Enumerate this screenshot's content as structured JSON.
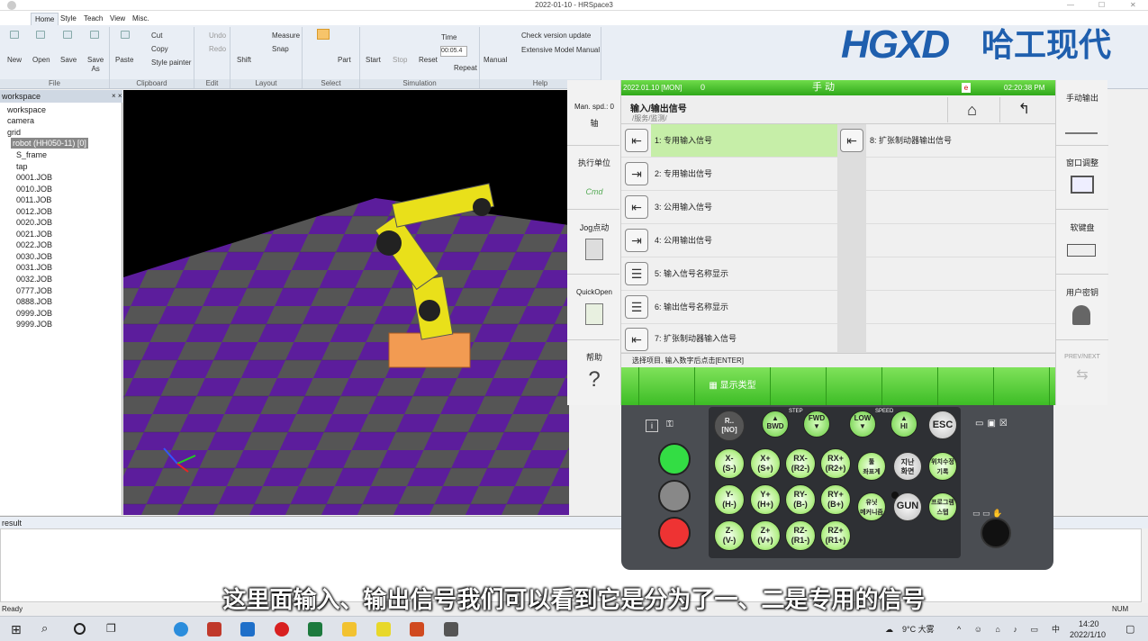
{
  "window": {
    "title": "2022-01-10 - HRSpace3"
  },
  "ribbon": {
    "tabs": [
      "Home",
      "Style",
      "Teach",
      "View",
      "Misc."
    ],
    "file": {
      "label": "File",
      "new": "New",
      "open": "Open",
      "save": "Save",
      "save_as": "Save\nAs"
    },
    "clipboard": {
      "label": "Clipboard",
      "paste": "Paste",
      "cut": "Cut",
      "copy": "Copy",
      "painter": "Style painter"
    },
    "edit": {
      "label": "Edit",
      "undo": "Undo",
      "redo": "Redo"
    },
    "layout": {
      "label": "Layout",
      "shift": "Shift",
      "measure": "Measure",
      "snap": "Snap"
    },
    "select": {
      "label": "Select",
      "part": "Part"
    },
    "simulation": {
      "label": "Simulation",
      "start": "Start",
      "stop": "Stop",
      "reset": "Reset",
      "time_label": "Time",
      "time_value": "00:05.4",
      "repeat": "Repeat"
    },
    "help": {
      "label": "Help",
      "manual": "Manual",
      "check": "Check version update",
      "ext": "Extensive Model Manual"
    }
  },
  "logo": {
    "en": "HGXD",
    "cn": "哈工现代"
  },
  "workspace": {
    "title": "workspace",
    "items": [
      "workspace",
      "camera",
      "grid",
      "robot (HH050-11) [0]",
      "S_frame",
      "tap",
      "0001.JOB",
      "0010.JOB",
      "0011.JOB",
      "0012.JOB",
      "0020.JOB",
      "0021.JOB",
      "0022.JOB",
      "0030.JOB",
      "0031.JOB",
      "0032.JOB",
      "0777.JOB",
      "0888.JOB",
      "0999.JOB",
      "9999.JOB"
    ]
  },
  "result": {
    "title": "result"
  },
  "status": {
    "left": "Ready",
    "right": "NUM"
  },
  "subtitle": "这里面输入、输出信号我们可以看到它是分为了一、二是专用的信号",
  "pendant": {
    "top": {
      "date": "2022.01.10 [MON]",
      "count": "0",
      "mode": "手  动",
      "time": "02:20:38 PM"
    },
    "title": "输入/输出信号",
    "path": "/服务/监测/",
    "left": {
      "speed": "Man. spd.: 0",
      "axis": "轴",
      "exec": "执行单位",
      "cmd": "Cmd",
      "jog": "Jog点动",
      "quick": "QuickOpen",
      "help": "帮助"
    },
    "right": {
      "manual": "手动输出",
      "window": "窗口调整",
      "keyboard": "软键盘",
      "user": "用户密钥",
      "prev_next": "PREV/NEXT"
    },
    "menu": [
      "1: 专用输入信号",
      "2: 专用输出信号",
      "3: 公用输入信号",
      "4: 公用输出信号",
      "5: 输入信号名称显示",
      "6: 输出信号名称显示",
      "7: 扩张制动器输入信号"
    ],
    "menu_right": [
      "8: 扩张制动器输出信号"
    ],
    "message": "选择项目, 输入数字后点击[ENTER]",
    "fkey": "显示类型"
  },
  "pad": {
    "step": "STEP",
    "speed": "SPEED",
    "bwd": "BWD",
    "fwd": "FWD",
    "low": "LOW",
    "hi": "HI",
    "esc": "ESC",
    "rno": "R..\n[NO]",
    "axes": [
      [
        "X-\n(S-)",
        "X+\n(S+)",
        "RX-\n(R2-)",
        "RX+\n(R2+)"
      ],
      [
        "Y-\n(H-)",
        "Y+\n(H+)",
        "RY-\n(B-)",
        "RY+\n(B+)"
      ],
      [
        "Z-\n(V-)",
        "Z+\n(V+)",
        "RZ-\n(R1-)",
        "RZ+\n(R1+)"
      ]
    ],
    "k1": "툴\n좌표계",
    "k2": "지난\n화면",
    "k3": "위치수정\n기록",
    "k4": "유닛\n메커니즘",
    "k5": "GUN",
    "k6": "프로그램\n스텝"
  },
  "taskbar": {
    "weather": "9°C 大雾",
    "lang": "中",
    "time": "14:20",
    "date": "2022/1/10"
  }
}
